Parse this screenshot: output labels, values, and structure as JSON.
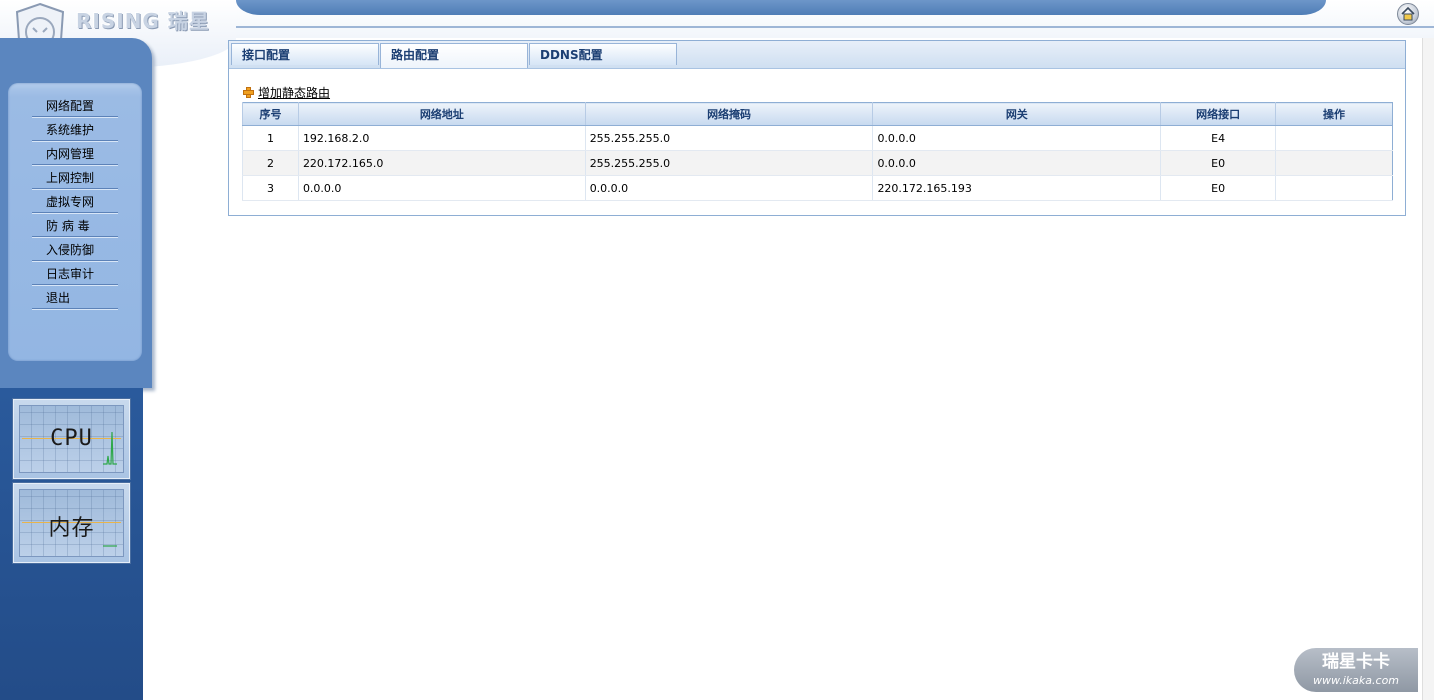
{
  "brand": {
    "logo_text": "RISING 瑞星",
    "shield_icon": "lion-shield-icon"
  },
  "header": {
    "home_icon": "home-icon"
  },
  "sidebar": {
    "items": [
      {
        "label": "网络配置"
      },
      {
        "label": "系统维护"
      },
      {
        "label": "内网管理"
      },
      {
        "label": "上网控制"
      },
      {
        "label": "虚拟专网"
      },
      {
        "label": "防 病 毒"
      },
      {
        "label": "入侵防御"
      },
      {
        "label": "日志审计"
      },
      {
        "label": "退出"
      }
    ],
    "monitors": [
      {
        "label": "CPU"
      },
      {
        "label": "内存"
      }
    ]
  },
  "tabs": [
    {
      "label": "接口配置",
      "active": false
    },
    {
      "label": "路由配置",
      "active": true
    },
    {
      "label": "DDNS配置",
      "active": false
    }
  ],
  "add_route_label": "增加静态路由",
  "table": {
    "headers": [
      "序号",
      "网络地址",
      "网络掩码",
      "网关",
      "网络接口",
      "操作"
    ],
    "rows": [
      [
        "1",
        "192.168.2.0",
        "255.255.255.0",
        "0.0.0.0",
        "E4",
        ""
      ],
      [
        "2",
        "220.172.165.0",
        "255.255.255.0",
        "0.0.0.0",
        "E0",
        ""
      ],
      [
        "3",
        "0.0.0.0",
        "0.0.0.0",
        "220.172.165.193",
        "E0",
        ""
      ]
    ]
  },
  "watermark": {
    "title": "瑞星卡卡",
    "url": "www.ikaka.com"
  },
  "colors": {
    "sidebar": "#5b86bf",
    "header_bar": "#4f7db6",
    "table_header_text": "#1c3f73"
  }
}
